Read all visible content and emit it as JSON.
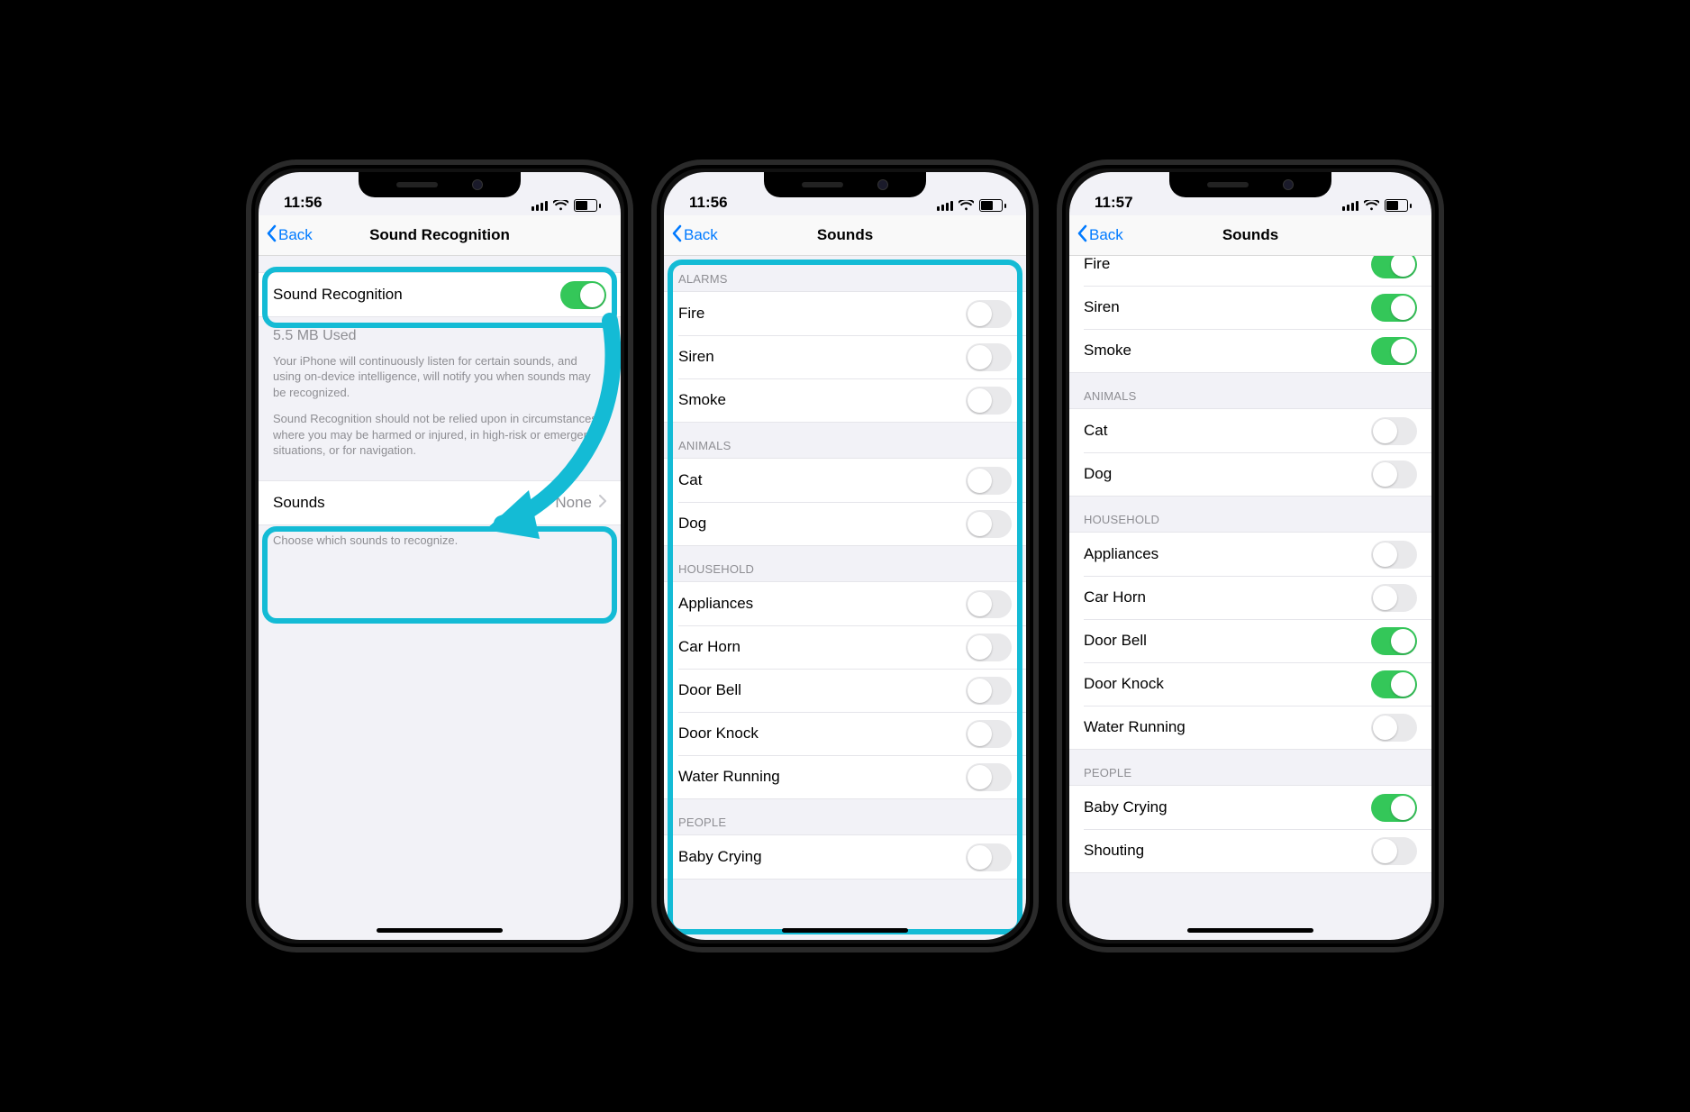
{
  "colors": {
    "highlight": "#14bbd5",
    "ios_blue": "#007aff",
    "ios_green": "#34c759"
  },
  "phone1": {
    "time": "11:56",
    "back_label": "Back",
    "title": "Sound Recognition",
    "main_row_label": "Sound Recognition",
    "main_row_on": true,
    "storage_text": "5.5 MB Used",
    "desc1": "Your iPhone will continuously listen for certain sounds, and using on-device intelligence, will notify you when sounds may be recognized.",
    "desc2": "Sound Recognition should not be relied upon in circumstances where you may be harmed or injured, in high-risk or emergency situations, or for navigation.",
    "sounds_row_label": "Sounds",
    "sounds_row_value": "None",
    "sounds_footer": "Choose which sounds to recognize."
  },
  "phone2": {
    "time": "11:56",
    "back_label": "Back",
    "title": "Sounds",
    "sections": [
      {
        "header": "ALARMS",
        "rows": [
          {
            "label": "Fire",
            "on": false
          },
          {
            "label": "Siren",
            "on": false
          },
          {
            "label": "Smoke",
            "on": false
          }
        ]
      },
      {
        "header": "ANIMALS",
        "rows": [
          {
            "label": "Cat",
            "on": false
          },
          {
            "label": "Dog",
            "on": false
          }
        ]
      },
      {
        "header": "HOUSEHOLD",
        "rows": [
          {
            "label": "Appliances",
            "on": false
          },
          {
            "label": "Car Horn",
            "on": false
          },
          {
            "label": "Door Bell",
            "on": false
          },
          {
            "label": "Door Knock",
            "on": false
          },
          {
            "label": "Water Running",
            "on": false
          }
        ]
      },
      {
        "header": "PEOPLE",
        "rows": [
          {
            "label": "Baby Crying",
            "on": false
          }
        ]
      }
    ]
  },
  "phone3": {
    "time": "11:57",
    "back_label": "Back",
    "title": "Sounds",
    "sections": [
      {
        "header": null,
        "rows": [
          {
            "label": "Fire",
            "on": true
          },
          {
            "label": "Siren",
            "on": true
          },
          {
            "label": "Smoke",
            "on": true
          }
        ]
      },
      {
        "header": "ANIMALS",
        "rows": [
          {
            "label": "Cat",
            "on": false
          },
          {
            "label": "Dog",
            "on": false
          }
        ]
      },
      {
        "header": "HOUSEHOLD",
        "rows": [
          {
            "label": "Appliances",
            "on": false
          },
          {
            "label": "Car Horn",
            "on": false
          },
          {
            "label": "Door Bell",
            "on": true
          },
          {
            "label": "Door Knock",
            "on": true
          },
          {
            "label": "Water Running",
            "on": false
          }
        ]
      },
      {
        "header": "PEOPLE",
        "rows": [
          {
            "label": "Baby Crying",
            "on": true
          },
          {
            "label": "Shouting",
            "on": false
          }
        ]
      }
    ]
  }
}
